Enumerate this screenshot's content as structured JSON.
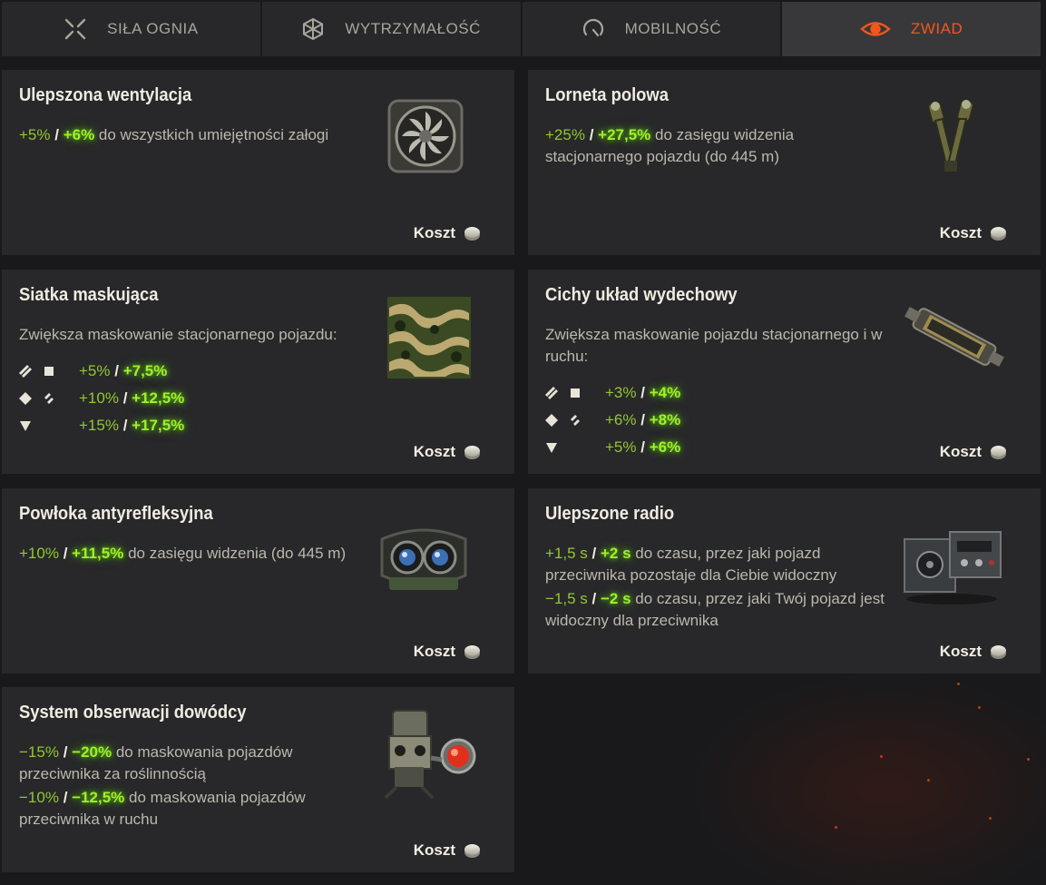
{
  "tabs": [
    {
      "label": "SIŁA OGNIA",
      "icon": "crosshair-icon",
      "active": false
    },
    {
      "label": "WYTRZYMAŁOŚĆ",
      "icon": "armor-icon",
      "active": false
    },
    {
      "label": "MOBILNOŚĆ",
      "icon": "speedometer-icon",
      "active": false
    },
    {
      "label": "ZWIAD",
      "icon": "eye-icon",
      "active": true
    }
  ],
  "colors": {
    "accent": "#f2561d",
    "value_base": "#93c730",
    "value_bonus": "#9ff02a",
    "card_bg": "#28282a"
  },
  "cost_label": "Koszt",
  "cards": [
    {
      "title": "Ulepszona wentylacja",
      "image": "ventilation-fan",
      "lines": [
        {
          "base": "+5%",
          "sep": "/",
          "bonus": "+6%",
          "text": " do wszystkich umiejętności załogi"
        }
      ]
    },
    {
      "title": "Lorneta polowa",
      "image": "binocular-periscope",
      "lines": [
        {
          "base": "+25%",
          "sep": "/",
          "bonus": "+27,5%",
          "text": " do zasięgu widzenia stacjonarnego pojazdu (do 445 m)"
        }
      ]
    },
    {
      "title": "Siatka maskująca",
      "image": "camouflage-net",
      "intro": "Zwiększa maskowanie stacjonarnego pojazdu:",
      "stats": [
        {
          "icons": [
            "light-tank-icon",
            "heavy-tank-icon"
          ],
          "base": "+5%",
          "sep": "/",
          "bonus": "+7,5%"
        },
        {
          "icons": [
            "medium-tank-icon",
            "light-tank-icon"
          ],
          "base": "+10%",
          "sep": "/",
          "bonus": "+12,5%"
        },
        {
          "icons": [
            "tank-destroyer-icon"
          ],
          "base": "+15%",
          "sep": "/",
          "bonus": "+17,5%"
        }
      ]
    },
    {
      "title": "Cichy układ wydechowy",
      "image": "exhaust-pipe",
      "intro": "Zwiększa maskowanie pojazdu stacjonarnego i w ruchu:",
      "stats": [
        {
          "icons": [
            "light-tank-icon",
            "heavy-tank-icon"
          ],
          "base": "+3%",
          "sep": "/",
          "bonus": "+4%"
        },
        {
          "icons": [
            "medium-tank-icon",
            "light-tank-icon"
          ],
          "base": "+6%",
          "sep": "/",
          "bonus": "+8%"
        },
        {
          "icons": [
            "tank-destroyer-icon"
          ],
          "base": "+5%",
          "sep": "/",
          "bonus": "+6%"
        }
      ]
    },
    {
      "title": "Powłoka antyrefleksyjna",
      "image": "optics-lens",
      "lines": [
        {
          "base": "+10%",
          "sep": "/",
          "bonus": "+11,5%",
          "text": " do zasięgu widzenia (do 445 m)"
        }
      ]
    },
    {
      "title": "Ulepszone radio",
      "image": "radio-set",
      "lines": [
        {
          "base": "+1,5 s",
          "sep": "/",
          "bonus": "+2 s",
          "text": " do czasu, przez jaki pojazd przeciwnika pozostaje dla Ciebie widoczny"
        },
        {
          "base": "−1,5 s",
          "sep": "/",
          "bonus": "−2 s",
          "text": " do czasu, przez jaki Twój pojazd jest widoczny dla przeciwnika"
        }
      ]
    },
    {
      "title": "System obserwacji dowódcy",
      "image": "observation-system",
      "lines": [
        {
          "base": "−15%",
          "sep": "/",
          "bonus": "−20%",
          "text": " do maskowania pojazdów przeciwnika za roślinnością"
        },
        {
          "base": "−10%",
          "sep": "/",
          "bonus": "−12,5%",
          "text": " do maskowania pojazdów przeciwnika w ruchu"
        }
      ]
    }
  ]
}
